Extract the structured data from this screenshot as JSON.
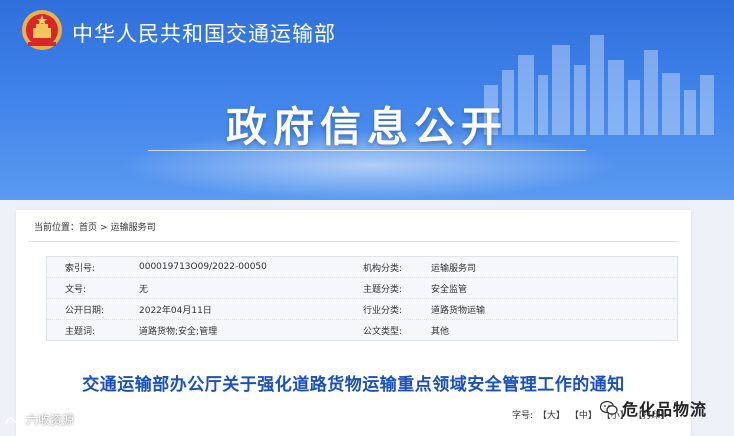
{
  "header": {
    "ministry_name": "中华人民共和国交通运输部",
    "hero_title": "政府信息公开"
  },
  "breadcrumb": {
    "label": "当前位置：",
    "items": [
      "首页",
      "运输服务司"
    ],
    "separator": ">"
  },
  "meta": {
    "rows": [
      {
        "k1": "索引号:",
        "v1": "000019713O09/2022-00050",
        "k2": "机构分类:",
        "v2": "运输服务司"
      },
      {
        "k1": "文号:",
        "v1": "无",
        "k2": "主题分类:",
        "v2": "安全监管"
      },
      {
        "k1": "公开日期:",
        "v1": "2022年04月11日",
        "k2": "行业分类:",
        "v2": "道路货物运输"
      },
      {
        "k1": "主题词:",
        "v1": "道路货物;安全;管理",
        "k2": "公文类型:",
        "v2": "其他"
      }
    ]
  },
  "document": {
    "title": "交通运输部办公厅关于强化道路货物运输重点领域安全管理工作的通知"
  },
  "font_size": {
    "label": "字号:",
    "large": "【大】",
    "medium": "【中】",
    "small": "【小】",
    "print": "【打印】"
  },
  "watermarks": {
    "left": "六收资源",
    "right": "危化品物流"
  },
  "colors": {
    "banner": "#3f82ea",
    "title_blue": "#1a4fbf"
  }
}
